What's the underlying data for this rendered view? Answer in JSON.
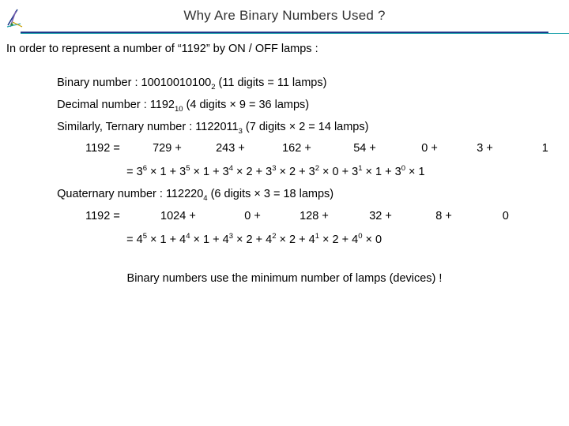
{
  "slide": {
    "title": "Why Are Binary Numbers Used ?",
    "intro": "In order to represent a number of “1192” by ON / OFF lamps :",
    "lines": {
      "binary": {
        "label": "Binary number : ",
        "value": "10010010100",
        "base": "2",
        "note": " (11 digits = 11 lamps)"
      },
      "decimal": {
        "label": "Decimal number : ",
        "value": "1192",
        "base": "10",
        "note": " (4 digits × 9 = 36 lamps)"
      },
      "ternary": {
        "label": "Similarly, Ternary number : ",
        "value": "1122011",
        "base": "3",
        "note": " (7 digits × 2 = 14 lamps)"
      },
      "quaternary": {
        "label": "Quaternary number : ",
        "value": "112220",
        "base": "4",
        "note": " (6 digits × 3 = 18 lamps)"
      }
    },
    "ternary_sum": {
      "lhs": "1192 =",
      "terms": [
        "729 +",
        "243 +",
        "162 +",
        "54 +",
        "0 +",
        "3 +",
        "1"
      ]
    },
    "ternary_expansion": {
      "prefix": "=  3",
      "parts": [
        {
          "base": "3",
          "exp": "6",
          "mult": " × 1 + "
        },
        {
          "base": "3",
          "exp": "5",
          "mult": " × 1 + "
        },
        {
          "base": "3",
          "exp": "4",
          "mult": " × 2 + "
        },
        {
          "base": "3",
          "exp": "3",
          "mult": " × 2 + "
        },
        {
          "base": "3",
          "exp": "2",
          "mult": " × 0 + "
        },
        {
          "base": "3",
          "exp": "1",
          "mult": " × 1 + "
        },
        {
          "base": "3",
          "exp": "0",
          "mult": " × 1"
        }
      ]
    },
    "quaternary_sum": {
      "lhs": "1192 =",
      "terms": [
        "1024 +",
        "0 +",
        "128 +",
        "32 +",
        "8 +",
        "0"
      ]
    },
    "quaternary_expansion": {
      "parts": [
        {
          "base": "4",
          "exp": "5",
          "mult": " × 1 + "
        },
        {
          "base": "4",
          "exp": "4",
          "mult": " × 1 + "
        },
        {
          "base": "4",
          "exp": "3",
          "mult": " × 2 + "
        },
        {
          "base": "4",
          "exp": "2",
          "mult": " × 2 + "
        },
        {
          "base": "4",
          "exp": "1",
          "mult": " × 2 + "
        },
        {
          "base": "4",
          "exp": "0",
          "mult": " × 0"
        }
      ]
    },
    "conclusion": "Binary numbers use the minimum number of lamps (devices) !",
    "colors": {
      "rule_dark": "#1f3a8a",
      "rule_teal": "#2aa8b0",
      "title_text": "#333333"
    }
  }
}
